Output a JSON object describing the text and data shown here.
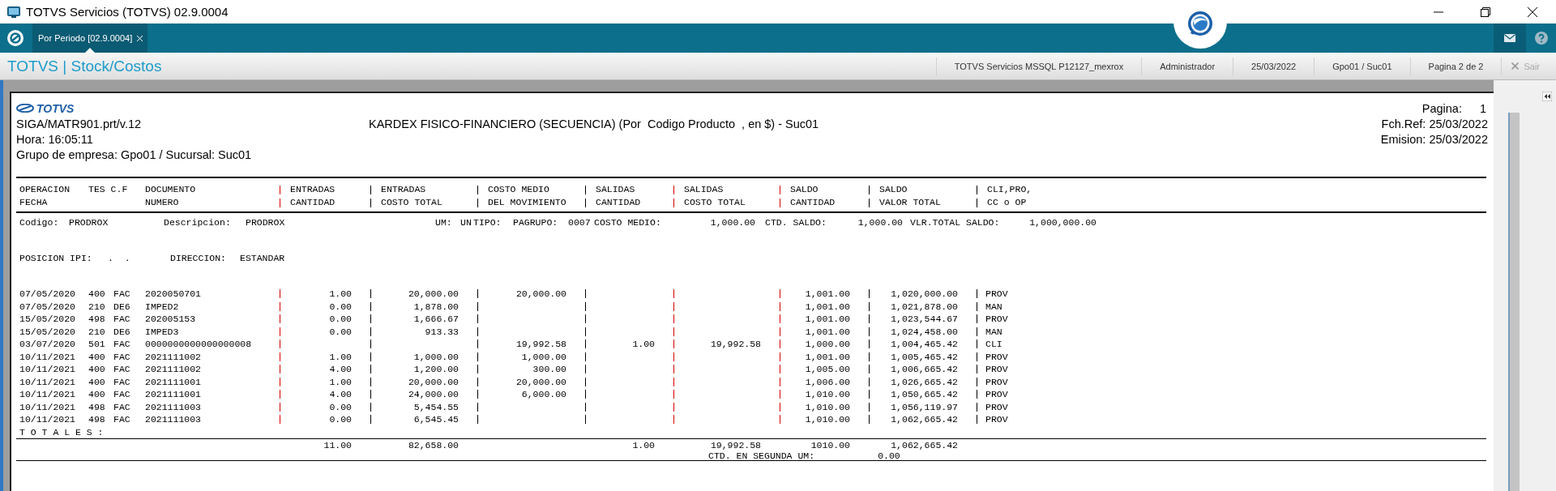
{
  "window": {
    "title": "TOTVS Servicios (TOTVS) 02.9.0004"
  },
  "tabs": [
    {
      "label": "Por Periodo [02.9.0004]",
      "selected": true
    }
  ],
  "module_title": "TOTVS | Stock/Costos",
  "status_items": [
    "TOTVS Servicios MSSQL P12127_mexrox",
    "Administrador",
    "25/03/2022",
    "Gpo01 / Suc01",
    "Pagina 2 de 2"
  ],
  "exit_button": {
    "label": "Sair",
    "disabled": true
  },
  "report": {
    "logo": "TOTVS",
    "program": "SIGA/MATR901.prt/v.12",
    "title": "KARDEX FISICO-FINANCIERO (SECUENCIA) (Por  Codigo Producto  , en $) - Suc01",
    "time": "Hora: 16:05:11",
    "group": "Grupo de empresa: Gpo01 / Sucursal: Suc01",
    "page_label": "Pagina:",
    "page_value": "1",
    "ref_date": "Fch.Ref: 25/03/2022",
    "issue_date": "Emision: 25/03/2022"
  },
  "table": {
    "columns": [
      {
        "line1": "OPERACION",
        "line2": "FECHA"
      },
      {
        "line1": "TES C.F"
      },
      {
        "line1": "DOCUMENTO",
        "line2": "NUMERO"
      },
      {
        "line1": "ENTRADAS",
        "line2": "CANTIDAD",
        "color": "#d40000"
      },
      {
        "line1": "ENTRADAS",
        "line2": "COSTO TOTAL",
        "color": "#000000"
      },
      {
        "line1": "COSTO MEDIO",
        "line2": "DEL MOVIMIENTO",
        "color": "#000000"
      },
      {
        "line1": "SALIDAS",
        "line2": "CANTIDAD",
        "color": "#000000"
      },
      {
        "line1": "SALIDAS",
        "line2": "COSTO TOTAL",
        "color": "#d40000"
      },
      {
        "line1": "SALDO",
        "line2": "CANTIDAD",
        "color": "#d40000"
      },
      {
        "line1": "SALDO",
        "line2": "VALOR TOTAL",
        "color": "#000000"
      },
      {
        "line1": "CLI,PRO,",
        "line2": "CC o OP",
        "color": "#000000"
      }
    ],
    "product_line": [
      "Codigo:",
      "PRODROX",
      "Descripcion:",
      "PRODROX",
      "UM:",
      "UN",
      "TIPO:",
      "PAGRUPO:",
      "0007",
      "COSTO MEDIO:",
      "1,000.00",
      "CTD. SALDO:",
      "1,000.00",
      "VLR.TOTAL SALDO:",
      "1,000,000.00"
    ],
    "position_line": [
      "POSICION IPI:",
      ".  .",
      "DIRECCION:",
      "ESTANDAR"
    ],
    "rows": [
      {
        "fecha": "07/05/2020",
        "tes": "400",
        "cf": "FAC",
        "documento": "2020050701",
        "entradas_cantidad": "1.00",
        "entradas_costo_total": "20,000.00",
        "costo_medio": "20,000.00",
        "saldo_cantidad": "1,001.00",
        "saldo_valor_total": "1,020,000.00",
        "cli_pro": "PROV"
      },
      {
        "fecha": "07/05/2020",
        "tes": "210",
        "cf": "DE6",
        "documento": "IMPED2",
        "entradas_cantidad": "0.00",
        "entradas_costo_total": "1,878.00",
        "saldo_cantidad": "1,001.00",
        "saldo_valor_total": "1,021,878.00",
        "cli_pro": "MAN"
      },
      {
        "fecha": "15/05/2020",
        "tes": "498",
        "cf": "FAC",
        "documento": "202005153",
        "entradas_cantidad": "0.00",
        "entradas_costo_total": "1,666.67",
        "saldo_cantidad": "1,001.00",
        "saldo_valor_total": "1,023,544.67",
        "cli_pro": "PROV"
      },
      {
        "fecha": "15/05/2020",
        "tes": "210",
        "cf": "DE6",
        "documento": "IMPED3",
        "entradas_cantidad": "0.00",
        "entradas_costo_total": "913.33",
        "saldo_cantidad": "1,001.00",
        "saldo_valor_total": "1,024,458.00",
        "cli_pro": "MAN"
      },
      {
        "fecha": "03/07/2020",
        "tes": "501",
        "cf": "FAC",
        "documento": "0000000000000000008",
        "costo_medio": "19,992.58",
        "salidas_cantidad": "1.00",
        "salidas_costo_total": "19,992.58",
        "saldo_cantidad": "1,000.00",
        "saldo_valor_total": "1,004,465.42",
        "cli_pro": "CLI"
      },
      {
        "fecha": "10/11/2021",
        "tes": "400",
        "cf": "FAC",
        "documento": "2021111002",
        "entradas_cantidad": "1.00",
        "entradas_costo_total": "1,000.00",
        "costo_medio": "1,000.00",
        "saldo_cantidad": "1,001.00",
        "saldo_valor_total": "1,005,465.42",
        "cli_pro": "PROV"
      },
      {
        "fecha": "10/11/2021",
        "tes": "400",
        "cf": "FAC",
        "documento": "2021111002",
        "entradas_cantidad": "4.00",
        "entradas_costo_total": "1,200.00",
        "costo_medio": "300.00",
        "saldo_cantidad": "1,005.00",
        "saldo_valor_total": "1,006,665.42",
        "cli_pro": "PROV"
      },
      {
        "fecha": "10/11/2021",
        "tes": "400",
        "cf": "FAC",
        "documento": "2021111001",
        "entradas_cantidad": "1.00",
        "entradas_costo_total": "20,000.00",
        "costo_medio": "20,000.00",
        "saldo_cantidad": "1,006.00",
        "saldo_valor_total": "1,026,665.42",
        "cli_pro": "PROV"
      },
      {
        "fecha": "10/11/2021",
        "tes": "400",
        "cf": "FAC",
        "documento": "2021111001",
        "entradas_cantidad": "4.00",
        "entradas_costo_total": "24,000.00",
        "costo_medio": "6,000.00",
        "saldo_cantidad": "1,010.00",
        "saldo_valor_total": "1,050,665.42",
        "cli_pro": "PROV"
      },
      {
        "fecha": "10/11/2021",
        "tes": "498",
        "cf": "FAC",
        "documento": "2021111003",
        "entradas_cantidad": "0.00",
        "entradas_costo_total": "5,454.55",
        "saldo_cantidad": "1,010.00",
        "saldo_valor_total": "1,056,119.97",
        "cli_pro": "PROV"
      },
      {
        "fecha": "10/11/2021",
        "tes": "498",
        "cf": "FAC",
        "documento": "2021111003",
        "entradas_cantidad": "0.00",
        "entradas_costo_total": "6,545.45",
        "saldo_cantidad": "1,010.00",
        "saldo_valor_total": "1,062,665.42",
        "cli_pro": "PROV"
      }
    ],
    "totals_label": "T O T A L E S :",
    "totals": {
      "entradas_cantidad": "11.00",
      "entradas_costo_total": "82,658.00",
      "salidas_cantidad": "1.00",
      "salidas_costo_total": "19,992.58",
      "saldo_cantidad": "1010.00",
      "saldo_valor_total": "1,062,665.42"
    },
    "second_um": {
      "label": "CTD. EN SEGUNDA UM:",
      "value": "0.00"
    }
  }
}
